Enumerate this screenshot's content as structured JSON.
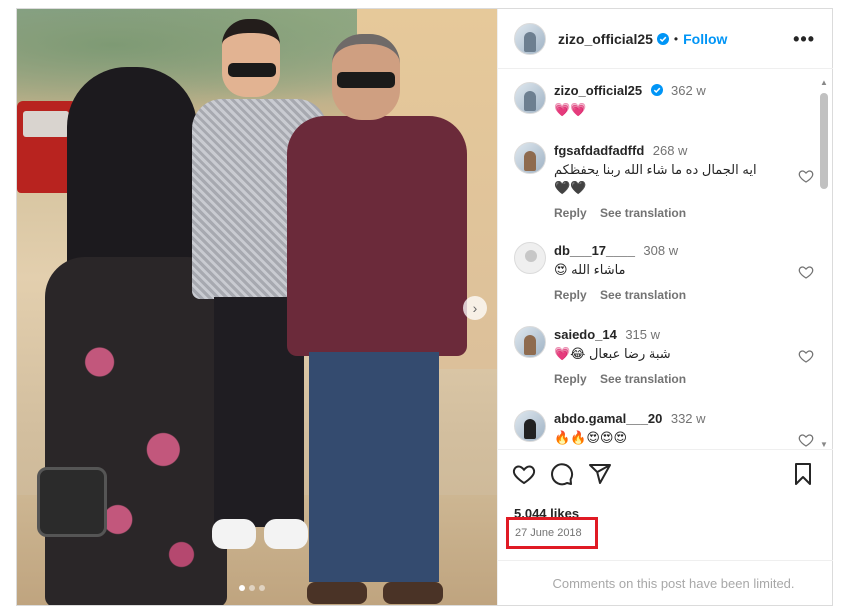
{
  "post": {
    "username": "zizo_official25",
    "verified": true,
    "dot": "•",
    "follow_label": "Follow",
    "more_label": "•••"
  },
  "caption": {
    "username": "zizo_official25",
    "time": "362 w",
    "text": "💗💗"
  },
  "comments": [
    {
      "username": "fgsafdadfadffd",
      "time": "268 w",
      "text_line1": "ايه الجمال ده ما شاء الله ربنا يحفظكم",
      "text_line2": "🖤🖤",
      "reply": "Reply",
      "translate": "See translation"
    },
    {
      "username": "db___17____",
      "time": "308 w",
      "text_line1": "ماشاء الله 😍",
      "reply": "Reply",
      "translate": "See translation"
    },
    {
      "username": "saiedo_14",
      "time": "315 w",
      "text_line1": "شبة رضا عبعال 😂💗",
      "reply": "Reply",
      "translate": "See translation"
    },
    {
      "username": "abdo.gamal___20",
      "time": "332 w",
      "text_line1": "🔥🔥😍😍😍",
      "reply": "",
      "translate": ""
    }
  ],
  "stats": {
    "likes": "5,044 likes",
    "date": "27 June 2018"
  },
  "footer": {
    "limited": "Comments on this post have been limited."
  },
  "icons": {
    "like": "heart-icon",
    "comment": "comment-icon",
    "share": "share-icon",
    "save": "bookmark-icon",
    "next": "chevron-right-icon"
  },
  "colors": {
    "accent": "#0095f6",
    "highlight_box": "#e01a24"
  }
}
